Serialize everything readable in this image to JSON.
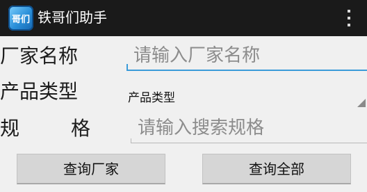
{
  "app": {
    "icon_text": "哥们",
    "title": "铁哥们助手"
  },
  "form": {
    "factory_label": "厂家名称",
    "factory_placeholder": "请输入厂家名称",
    "type_label": "产品类型",
    "type_selected": "产品类型",
    "spec_label_1": "规",
    "spec_label_2": "格",
    "spec_placeholder": "请输入搜索规格"
  },
  "buttons": {
    "query_factory": "查询厂家",
    "query_all": "查询全部"
  },
  "colors": {
    "actionbar": "#1a1a1a",
    "accent": "#3a9bd9",
    "background": "#f0f0f0"
  }
}
